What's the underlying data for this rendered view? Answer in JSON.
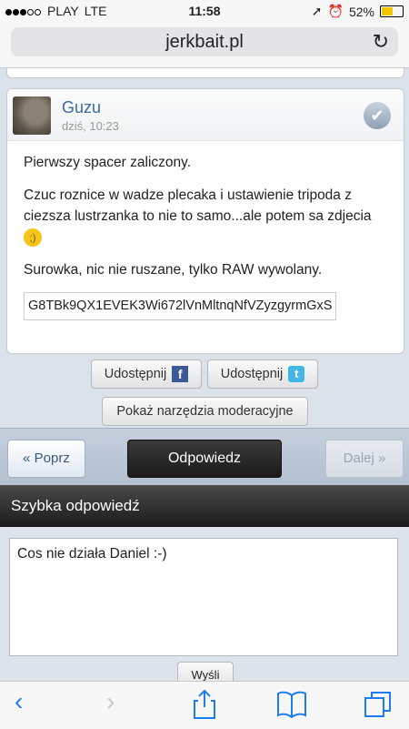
{
  "status": {
    "carrier": "PLAY",
    "network": "LTE",
    "time": "11:58",
    "battery": "52%",
    "battery_level": 0.52
  },
  "browser": {
    "url": "jerkbait.pl"
  },
  "post": {
    "author": "Guzu",
    "date": "dziś, 10:23",
    "paragraphs": [
      "Pierwszy spacer zaliczony.",
      "Czuc roznice w wadze plecaka i ustawienie tripoda z ciezsza lustrzanka to nie to samo...ale potem sa zdjecia",
      "Surowka, nic nie ruszane, tylko RAW wywolany."
    ],
    "code": "G8TBk9QX1EVEK3Wi672lVnMltnqNfVZyzgyrmGxS"
  },
  "share": {
    "facebook_label": "Udostępnij",
    "twitter_label": "Udostępnij",
    "mod_tools_label": "Pokaż narzędzia moderacyjne"
  },
  "nav": {
    "prev_label": "« Poprz",
    "reply_label": "Odpowiedz",
    "next_label": "Dalej »"
  },
  "quick_reply": {
    "title": "Szybka odpowiedź",
    "text": "Cos nie działa Daniel :-)",
    "send_label": "Wyśli"
  },
  "icons": {
    "back": "chevron-left-icon",
    "forward": "chevron-right-icon",
    "share": "share-icon",
    "bookmarks": "book-icon",
    "tabs": "tabs-icon"
  },
  "colors": {
    "accent": "#1c7cf5",
    "author": "#3a6aa0",
    "battery": "#f2c500"
  }
}
